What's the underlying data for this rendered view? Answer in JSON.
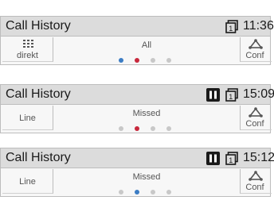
{
  "panels": [
    {
      "title": "Call History",
      "time": "11:36",
      "left_key": {
        "label": "direkt",
        "icon": "grid-icon"
      },
      "filter": "All",
      "filter_dots": [
        {
          "state": "active",
          "color": "#3c7dc4"
        },
        {
          "state": "active",
          "color": "#c8283c"
        },
        {
          "state": "inactive",
          "color": "#c8c8c8"
        },
        {
          "state": "inactive",
          "color": "#c8c8c8"
        }
      ],
      "right_key": {
        "label": "Conf",
        "icon": "conference-icon"
      },
      "status_icons": [
        "line-1-icon"
      ]
    },
    {
      "title": "Call History",
      "time": "15:09",
      "left_key": {
        "label": "Line"
      },
      "filter": "Missed",
      "filter_dots": [
        {
          "state": "inactive",
          "color": "#c8c8c8"
        },
        {
          "state": "active",
          "color": "#c8283c"
        },
        {
          "state": "inactive",
          "color": "#c8c8c8"
        },
        {
          "state": "inactive",
          "color": "#c8c8c8"
        }
      ],
      "right_key": {
        "label": "Conf",
        "icon": "conference-icon"
      },
      "status_icons": [
        "hold-icon",
        "line-1-icon"
      ]
    },
    {
      "title": "Call History",
      "time": "15:12",
      "left_key": {
        "label": "Line"
      },
      "filter": "Missed",
      "filter_dots": [
        {
          "state": "inactive",
          "color": "#c8c8c8"
        },
        {
          "state": "active",
          "color": "#3c7dc4"
        },
        {
          "state": "inactive",
          "color": "#c8c8c8"
        },
        {
          "state": "inactive",
          "color": "#c8c8c8"
        }
      ],
      "right_key": {
        "label": "Conf",
        "icon": "conference-icon"
      },
      "status_icons": [
        "hold-icon",
        "line-1-icon"
      ]
    }
  ],
  "line_icon_text": "1"
}
